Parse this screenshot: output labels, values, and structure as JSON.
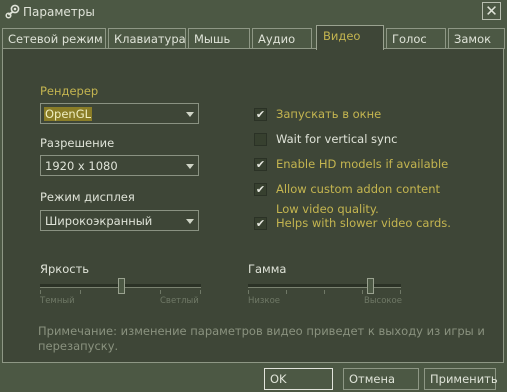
{
  "window": {
    "title": "Параметры",
    "close_glyph": "✕"
  },
  "tabs": [
    {
      "label": "Сетевой режим"
    },
    {
      "label": "Клавиатура"
    },
    {
      "label": "Мышь"
    },
    {
      "label": "Аудио"
    },
    {
      "label": "Видео",
      "active": true
    },
    {
      "label": "Голос"
    },
    {
      "label": "Замок"
    }
  ],
  "video": {
    "renderer": {
      "label": "Рендерер",
      "value": "OpenGL"
    },
    "resolution": {
      "label": "Разрешение",
      "value": "1920 x 1080"
    },
    "display_mode": {
      "label": "Режим дисплея",
      "value": "Широкоэкранный"
    },
    "options": [
      {
        "label": "Запускать в окне",
        "checked": true
      },
      {
        "label": "Wait for vertical sync",
        "checked": false
      },
      {
        "label": "Enable HD models if available",
        "checked": true
      },
      {
        "label": "Allow custom addon content",
        "checked": true
      },
      {
        "label": "Low video quality.",
        "label2": "Helps with slower video cards.",
        "checked": true
      }
    ],
    "brightness": {
      "label": "Яркость",
      "min_label": "Темный",
      "max_label": "Светлый",
      "value": 0.5
    },
    "gamma": {
      "label": "Гамма",
      "min_label": "Низкое",
      "max_label": "Высокое",
      "value": 0.8
    },
    "note": "Примечание: изменение параметров видео приведет к выходу из игры и перезапуску."
  },
  "buttons": {
    "ok": "OK",
    "cancel": "Отмена",
    "apply": "Применить"
  },
  "colors": {
    "background": "#4c5844",
    "panel": "#3e4637",
    "accent": "#c4b550",
    "text": "#dfe3d8"
  },
  "icons": {
    "app": "steam-icon",
    "check": "✔"
  }
}
